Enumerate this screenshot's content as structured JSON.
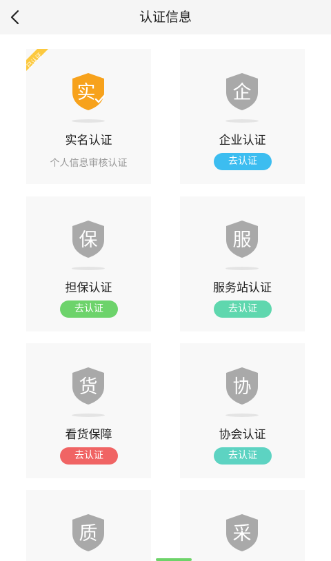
{
  "header": {
    "title": "认证信息"
  },
  "cards": [
    {
      "char": "实",
      "name": "实名认证",
      "badge": "已认证",
      "subtitle": "个人信息审核认证",
      "status": "verified"
    },
    {
      "char": "企",
      "name": "企业认证",
      "button": "去认证",
      "button_color": "#3cbdf0"
    },
    {
      "char": "保",
      "name": "担保认证",
      "button": "去认证",
      "button_color": "#6dd36b"
    },
    {
      "char": "服",
      "name": "服务站认证",
      "button": "去认证",
      "button_color": "#5fd7ae"
    },
    {
      "char": "货",
      "name": "看货保障",
      "button": "去认证",
      "button_color": "#f06464"
    },
    {
      "char": "协",
      "name": "协会认证",
      "button": "去认证",
      "button_color": "#5dd3c2"
    },
    {
      "char": "质"
    },
    {
      "char": "采"
    }
  ],
  "colors": {
    "shield_gray": "#a9a9a9",
    "shield_orange": "#f7a21c",
    "ribbon": "#fcc93f"
  }
}
